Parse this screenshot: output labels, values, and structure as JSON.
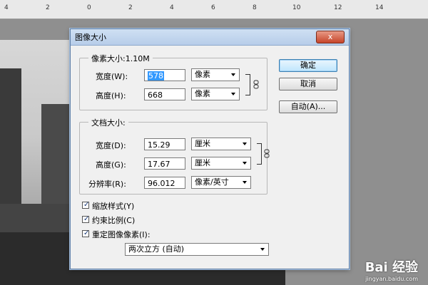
{
  "ruler": {
    "labels": [
      "4",
      "2",
      "0",
      "2",
      "4",
      "6",
      "8",
      "10",
      "12",
      "14"
    ]
  },
  "dialog": {
    "title": "图像大小",
    "close_label": "x",
    "pixel_size": {
      "legend": "像素大小:1.10M",
      "width_label": "宽度(W):",
      "width_value": "578",
      "width_unit": "像素",
      "height_label": "高度(H):",
      "height_value": "668",
      "height_unit": "像素"
    },
    "doc_size": {
      "legend": "文档大小:",
      "width_label": "宽度(D):",
      "width_value": "15.29",
      "width_unit": "厘米",
      "height_label": "高度(G):",
      "height_value": "17.67",
      "height_unit": "厘米",
      "res_label": "分辨率(R):",
      "res_value": "96.012",
      "res_unit": "像素/英寸"
    },
    "buttons": {
      "ok": "确定",
      "cancel": "取消",
      "auto": "自动(A)..."
    },
    "checkboxes": {
      "scale_styles": "缩放样式(Y)",
      "constrain": "约束比例(C)",
      "resample": "重定图像像素(I):"
    },
    "resample_method": "两次立方 (自动)"
  },
  "watermark": {
    "text": "Bai 经验",
    "sub": "jingyan.baidu.com"
  }
}
